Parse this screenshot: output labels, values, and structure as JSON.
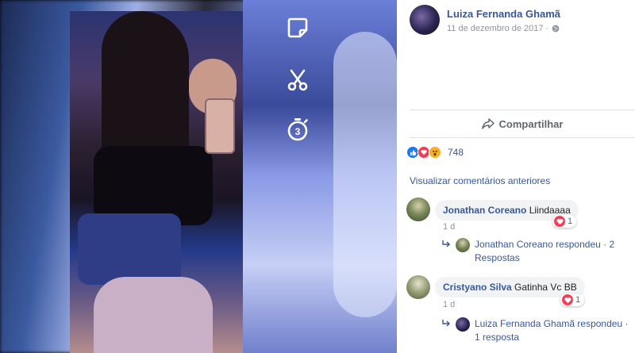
{
  "photo": {
    "snap_icons": [
      "sticker-icon",
      "scissors-icon",
      "timer-icon"
    ],
    "timer_value": "3"
  },
  "post": {
    "author": "Luiza Fernanda Ghamã",
    "date": "11 de dezembro de 2017 ·",
    "share_label": "Compartilhar",
    "reaction_count": "748"
  },
  "comments_section": {
    "view_previous": "Visualizar comentários anteriores",
    "items": [
      {
        "name": "Jonathan Coreano",
        "text": "Liindaaaa",
        "reactions": "1",
        "time": "1 d",
        "reply_by": "Jonathan Coreano respondeu",
        "reply_count": "· 2 Respostas"
      },
      {
        "name": "Cristyano Silva",
        "text": "Gatinha Vc BB",
        "reactions": "1",
        "time": "1 d",
        "reply_by": "Luiza Fernanda Ghamã respondeu",
        "reply_count": "· 1 resposta"
      }
    ]
  },
  "colors": {
    "link": "#365899",
    "love": "#f33e58",
    "like": "#1877f2",
    "wow": "#f7b125"
  }
}
